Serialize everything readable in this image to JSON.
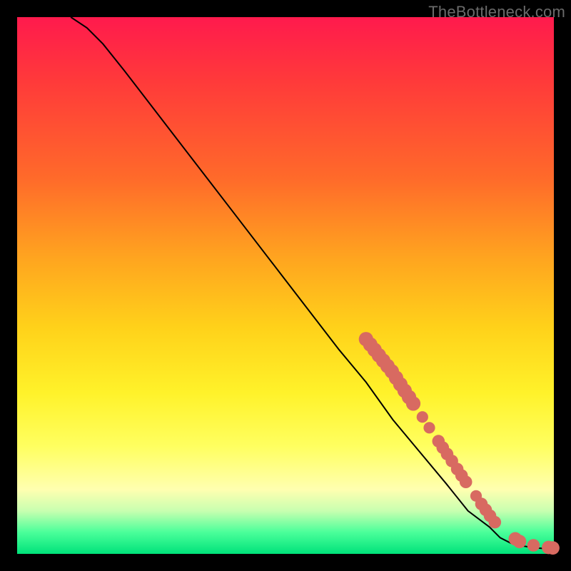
{
  "watermark": "TheBottleneck.com",
  "colors": {
    "dot": "#d86a61",
    "line": "#000000"
  },
  "chart_data": {
    "type": "line",
    "title": "",
    "xlabel": "",
    "ylabel": "",
    "xlim": [
      0,
      100
    ],
    "ylim": [
      0,
      100
    ],
    "grid": false,
    "legend": false,
    "series": [
      {
        "name": "curve",
        "x": [
          10,
          13,
          16,
          20,
          30,
          40,
          50,
          60,
          65,
          70,
          75,
          80,
          84,
          88,
          90,
          92,
          94,
          96,
          98,
          100
        ],
        "y": [
          100,
          98,
          95,
          90,
          77,
          64,
          51,
          38,
          32,
          25,
          19,
          13,
          8,
          5,
          3,
          2,
          1.5,
          1.2,
          1.0,
          1.0
        ]
      }
    ],
    "markers": [
      {
        "x": 65.0,
        "y": 40.0,
        "r": 1.2
      },
      {
        "x": 65.8,
        "y": 39.0,
        "r": 1.2
      },
      {
        "x": 66.6,
        "y": 38.0,
        "r": 1.2
      },
      {
        "x": 67.4,
        "y": 37.0,
        "r": 1.2
      },
      {
        "x": 68.2,
        "y": 36.0,
        "r": 1.2
      },
      {
        "x": 69.0,
        "y": 35.0,
        "r": 1.2
      },
      {
        "x": 69.8,
        "y": 34.0,
        "r": 1.2
      },
      {
        "x": 70.6,
        "y": 32.8,
        "r": 1.2
      },
      {
        "x": 71.4,
        "y": 31.6,
        "r": 1.2
      },
      {
        "x": 72.2,
        "y": 30.4,
        "r": 1.2
      },
      {
        "x": 73.0,
        "y": 29.2,
        "r": 1.2
      },
      {
        "x": 73.8,
        "y": 28.0,
        "r": 1.2
      },
      {
        "x": 75.5,
        "y": 25.5,
        "r": 0.9
      },
      {
        "x": 76.8,
        "y": 23.5,
        "r": 0.9
      },
      {
        "x": 78.5,
        "y": 21.0,
        "r": 1.0
      },
      {
        "x": 79.3,
        "y": 19.8,
        "r": 1.0
      },
      {
        "x": 80.1,
        "y": 18.6,
        "r": 1.0
      },
      {
        "x": 81.0,
        "y": 17.3,
        "r": 1.0
      },
      {
        "x": 82.0,
        "y": 15.8,
        "r": 1.0
      },
      {
        "x": 82.8,
        "y": 14.6,
        "r": 1.0
      },
      {
        "x": 83.6,
        "y": 13.4,
        "r": 1.0
      },
      {
        "x": 85.5,
        "y": 10.8,
        "r": 0.9
      },
      {
        "x": 86.5,
        "y": 9.3,
        "r": 1.0
      },
      {
        "x": 87.3,
        "y": 8.2,
        "r": 1.0
      },
      {
        "x": 88.1,
        "y": 7.1,
        "r": 1.0
      },
      {
        "x": 89.0,
        "y": 5.9,
        "r": 1.0
      },
      {
        "x": 92.8,
        "y": 2.8,
        "r": 1.1
      },
      {
        "x": 93.6,
        "y": 2.3,
        "r": 1.1
      },
      {
        "x": 96.2,
        "y": 1.6,
        "r": 1.0
      },
      {
        "x": 99.0,
        "y": 1.2,
        "r": 1.1
      },
      {
        "x": 99.8,
        "y": 1.1,
        "r": 1.1
      }
    ]
  }
}
